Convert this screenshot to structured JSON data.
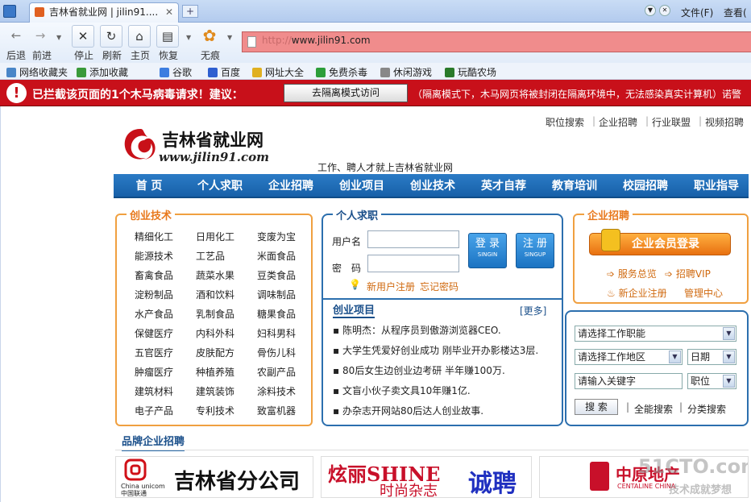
{
  "browser": {
    "tab_title": "吉林省就业网 | jilin91....",
    "menu_file": "文件(F)",
    "menu_view": "查看(",
    "nav_labels": {
      "back": "后退",
      "forward": "前进",
      "stop": "停止",
      "refresh": "刷新",
      "home": "主页",
      "restore": "恢复",
      "incognito": "无痕"
    },
    "address_prefix": "http://",
    "address_url": "www.jilin91.com",
    "favorites": [
      "网络收藏夹",
      "添加收藏",
      "谷歌",
      "百度",
      "网址大全",
      "免费杀毒",
      "休闲游戏",
      "玩酷农场"
    ]
  },
  "warning": {
    "icon": "!",
    "text": "已拦截该页面的1个木马病毒请求！建议：",
    "button": "去隔离模式访问",
    "detail": "（隔离模式下，木马网页将被封闭在隔离环境中，无法感染真实计算机）诺警"
  },
  "site": {
    "logo_text": "吉林省就业网",
    "logo_sub": "www.jilin91.com",
    "slogan": "工作、聘人才就上吉林省就业网",
    "top_links": [
      "职位搜索",
      "企业招聘",
      "行业联盟",
      "视频招聘"
    ],
    "nav": [
      "首 页",
      "个人求职",
      "企业招聘",
      "创业项目",
      "创业技术",
      "英才自荐",
      "教育培训",
      "校园招聘",
      "职业指导"
    ],
    "chuangye": {
      "title": "创业技术",
      "items": [
        "精细化工",
        "日用化工",
        "变废为宝",
        "能源技术",
        "工艺品",
        "米面食品",
        "畜禽食品",
        "蔬菜水果",
        "豆类食品",
        "淀粉制品",
        "酒和饮料",
        "调味制品",
        "水产食品",
        "乳制食品",
        "糖果食品",
        "保健医疗",
        "内科外科",
        "妇科男科",
        "五官医疗",
        "皮肤配方",
        "骨伤儿科",
        "肿瘤医疗",
        "种植养殖",
        "农副产品",
        "建筑材料",
        "建筑装饰",
        "涂料技术",
        "电子产品",
        "专利技术",
        "致富机器"
      ]
    },
    "qiuzhi": {
      "title": "个人求职",
      "username_label": "用户名",
      "password_label": "密　码",
      "login": "登 录",
      "login_sub": "SINGIN",
      "register": "注 册",
      "register_sub": "SINGUP",
      "new_user": "新用户注册",
      "forgot": "忘记密码"
    },
    "xiangmu": {
      "title": "创业项目",
      "more": "[更多]",
      "items": [
        "陈明杰：从程序员到傲游浏览器CEO.",
        "大学生凭爱好创业成功 刚毕业开办影楼达3层.",
        "80后女生边创业边考研 半年赚100万.",
        "文盲小伙子卖文具10年赚1亿.",
        "办杂志开网站80后达人创业故事."
      ]
    },
    "qiye": {
      "title": "企业招聘",
      "login": "企业会员登录",
      "links": [
        "服务总览",
        "招聘VIP",
        "新企业注册",
        "管理中心"
      ]
    },
    "search": {
      "job_type": "请选择工作职能",
      "area": "请选择工作地区",
      "date": "日期",
      "keyword": "请输入关键字",
      "field": "职位",
      "search_btn": "搜 索",
      "full": "全能搜索",
      "category": "分类搜索"
    },
    "brand": {
      "title": "品牌企业招聘",
      "unicom": "吉林省分公司",
      "unicom_logo": "China unicom中国联通",
      "shine": "炫丽SHINE",
      "shine_sub": "时尚杂志",
      "chengpin": "诚聘",
      "centaline": "中原地产",
      "centaline_sub": "CENTALINE CHINA",
      "watermark": "51CTO.com",
      "watermark_sub": "技术成就梦想"
    }
  }
}
